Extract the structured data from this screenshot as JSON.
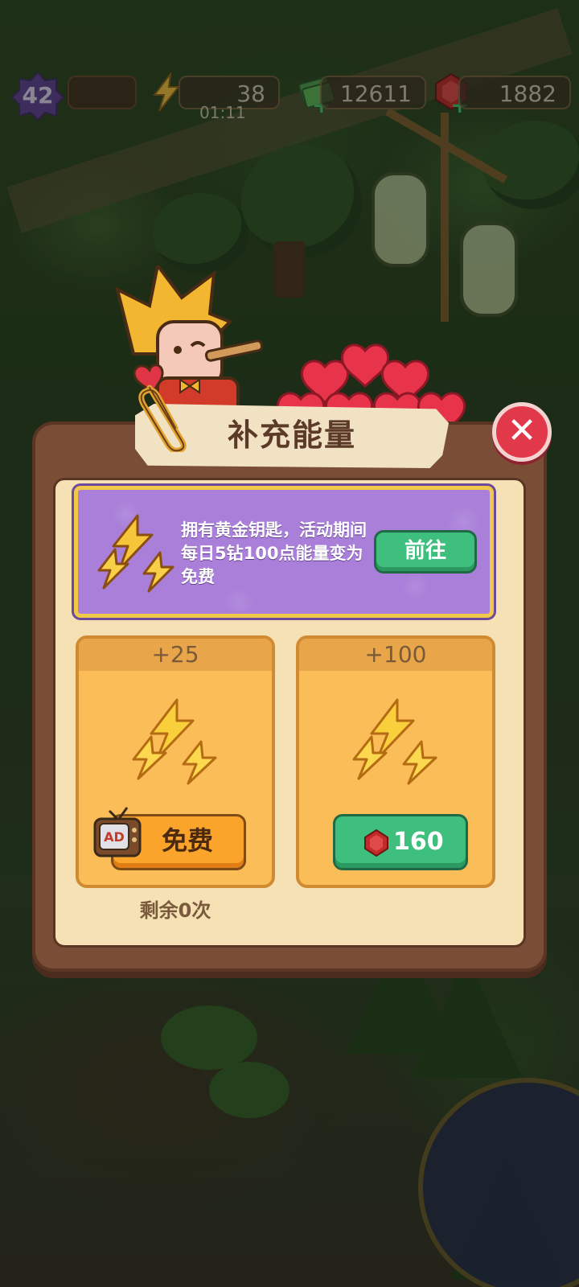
{
  "hud": {
    "level": "42",
    "energy": "38",
    "energy_timer": "01:11",
    "cash": "12611",
    "gems": "1882"
  },
  "dialog": {
    "title": "补充能量",
    "promo": {
      "text": "拥有黄金钥匙，活动期间每日5钻100点能量变为免费",
      "button": "前往"
    },
    "offers": [
      {
        "amount": "+25",
        "button": "免费",
        "button_type": "ad",
        "ad_label": "AD"
      },
      {
        "amount": "+100",
        "price": "160",
        "button_type": "gem"
      }
    ],
    "remaining": "剩余0次"
  },
  "colors": {
    "dialog_frame": "#7a4e36",
    "dialog_panel": "#f5e1b4",
    "promo_bg": "#a97fd9",
    "green_button": "#3fbf7e",
    "orange_button": "#fba42c",
    "close_red": "#e2394a",
    "card_bg": "#fbbd57"
  }
}
